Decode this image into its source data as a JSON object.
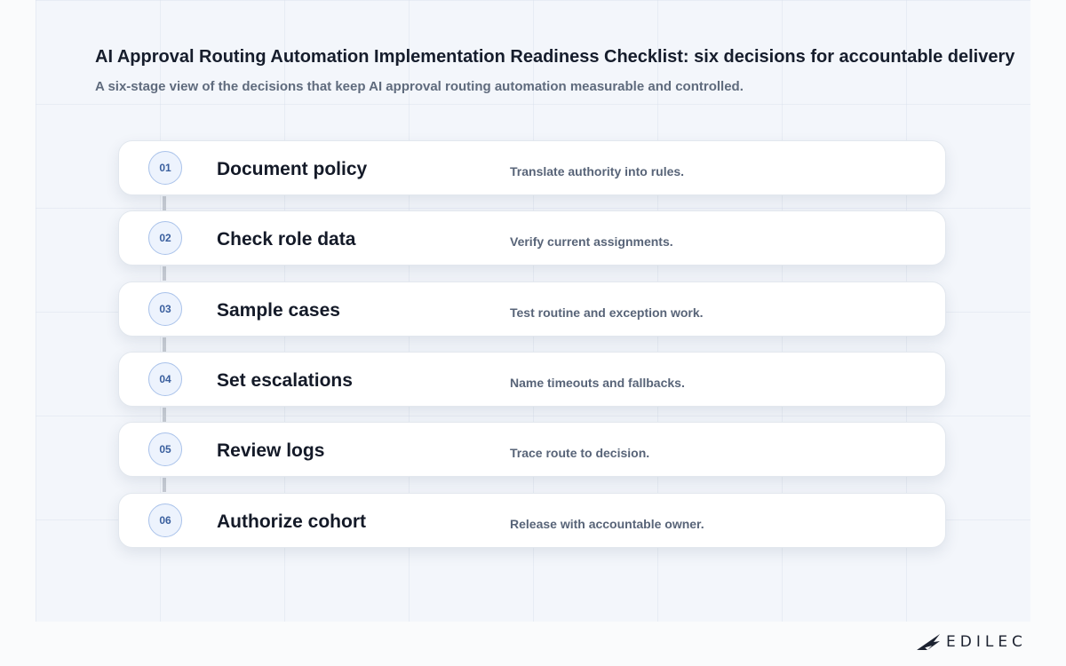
{
  "header": {
    "title": "AI Approval Routing Automation Implementation Readiness Checklist: six decisions for accountable delivery",
    "subtitle": "A six-stage view of the decisions that keep AI approval routing automation measurable and controlled."
  },
  "steps": [
    {
      "number": "01",
      "title": "Document policy",
      "description": "Translate authority into rules."
    },
    {
      "number": "02",
      "title": "Check role data",
      "description": "Verify current assignments."
    },
    {
      "number": "03",
      "title": "Sample cases",
      "description": "Test routine and exception work."
    },
    {
      "number": "04",
      "title": "Set escalations",
      "description": "Name timeouts and fallbacks."
    },
    {
      "number": "05",
      "title": "Review logs",
      "description": "Trace route to decision."
    },
    {
      "number": "06",
      "title": "Authorize cohort",
      "description": "Release with accountable owner."
    }
  ],
  "brand": {
    "name": "EDILEC",
    "icon": "edilec-wing-logo-icon"
  },
  "colors": {
    "background": "#f3f6fb",
    "badge_fill": "#edf3fd",
    "badge_border": "#a9c2ea",
    "badge_text": "#3a5f9e",
    "connector": "#c7ccd4",
    "title_text": "#161d2c",
    "muted_text": "#5f6b7d"
  }
}
